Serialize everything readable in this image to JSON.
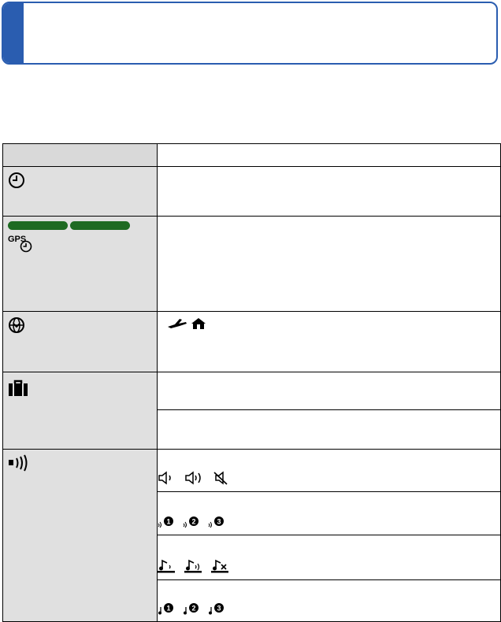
{
  "header": {
    "accent_color": "#2a5db0"
  },
  "table": {
    "rows": [
      {
        "item_icon": "clock-icon"
      },
      {
        "item_icon": "gps-clock-icon",
        "badges": 2,
        "badge_color": "#1e6a22"
      },
      {
        "item_icon": "world-time-icon",
        "option_icons": [
          "airplane-icon",
          "home-icon"
        ]
      },
      {
        "item_icon": "suitcase-icon"
      },
      {
        "item_icon": "speaker-beep-icon",
        "option_icons": [
          [
            "speaker-low-icon",
            "speaker-high-icon",
            "speaker-mute-icon"
          ],
          [
            "beep-tone-1-icon",
            "beep-tone-2-icon",
            "beep-tone-3-icon"
          ],
          [
            "shutter-volume-low-icon",
            "shutter-volume-high-icon",
            "shutter-volume-mute-icon"
          ],
          [
            "shutter-tone-1-icon",
            "shutter-tone-2-icon",
            "shutter-tone-3-icon"
          ]
        ]
      }
    ]
  }
}
